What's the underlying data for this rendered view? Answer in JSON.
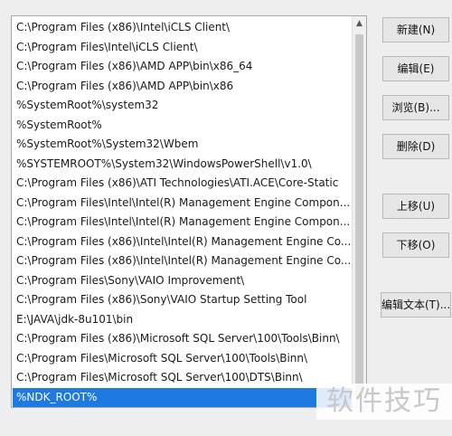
{
  "path_list": {
    "items": [
      "C:\\Program Files (x86)\\Intel\\iCLS Client\\",
      "C:\\Program Files\\Intel\\iCLS Client\\",
      "C:\\Program Files (x86)\\AMD APP\\bin\\x86_64",
      "C:\\Program Files (x86)\\AMD APP\\bin\\x86",
      "%SystemRoot%\\system32",
      "%SystemRoot%",
      "%SystemRoot%\\System32\\Wbem",
      "%SYSTEMROOT%\\System32\\WindowsPowerShell\\v1.0\\",
      "C:\\Program Files (x86)\\ATI Technologies\\ATI.ACE\\Core-Static",
      "C:\\Program Files\\Intel\\Intel(R) Management Engine Compon...",
      "C:\\Program Files\\Intel\\Intel(R) Management Engine Compon...",
      "C:\\Program Files (x86)\\Intel\\Intel(R) Management Engine Co...",
      "C:\\Program Files (x86)\\Intel\\Intel(R) Management Engine Co...",
      "C:\\Program Files\\Sony\\VAIO Improvement\\",
      "C:\\Program Files (x86)\\Sony\\VAIO Startup Setting Tool",
      "E:\\JAVA\\jdk-8u101\\bin",
      "C:\\Program Files (x86)\\Microsoft SQL Server\\100\\Tools\\Binn\\",
      "C:\\Program Files\\Microsoft SQL Server\\100\\Tools\\Binn\\",
      "C:\\Program Files\\Microsoft SQL Server\\100\\DTS\\Binn\\",
      "%NDK_ROOT%"
    ],
    "selected": "%NDK_ROOT%",
    "scroll_up_icon": "chevron-up-icon"
  },
  "buttons": {
    "new": "新建(N)",
    "edit": "编辑(E)",
    "browse": "浏览(B)...",
    "delete": "删除(D)",
    "move_up": "上移(U)",
    "move_down": "下移(O)",
    "edit_text": "编辑文本(T)..."
  },
  "watermark": "软件技巧",
  "colors": {
    "selection": "#1e79e0",
    "background": "#eeeeee"
  }
}
